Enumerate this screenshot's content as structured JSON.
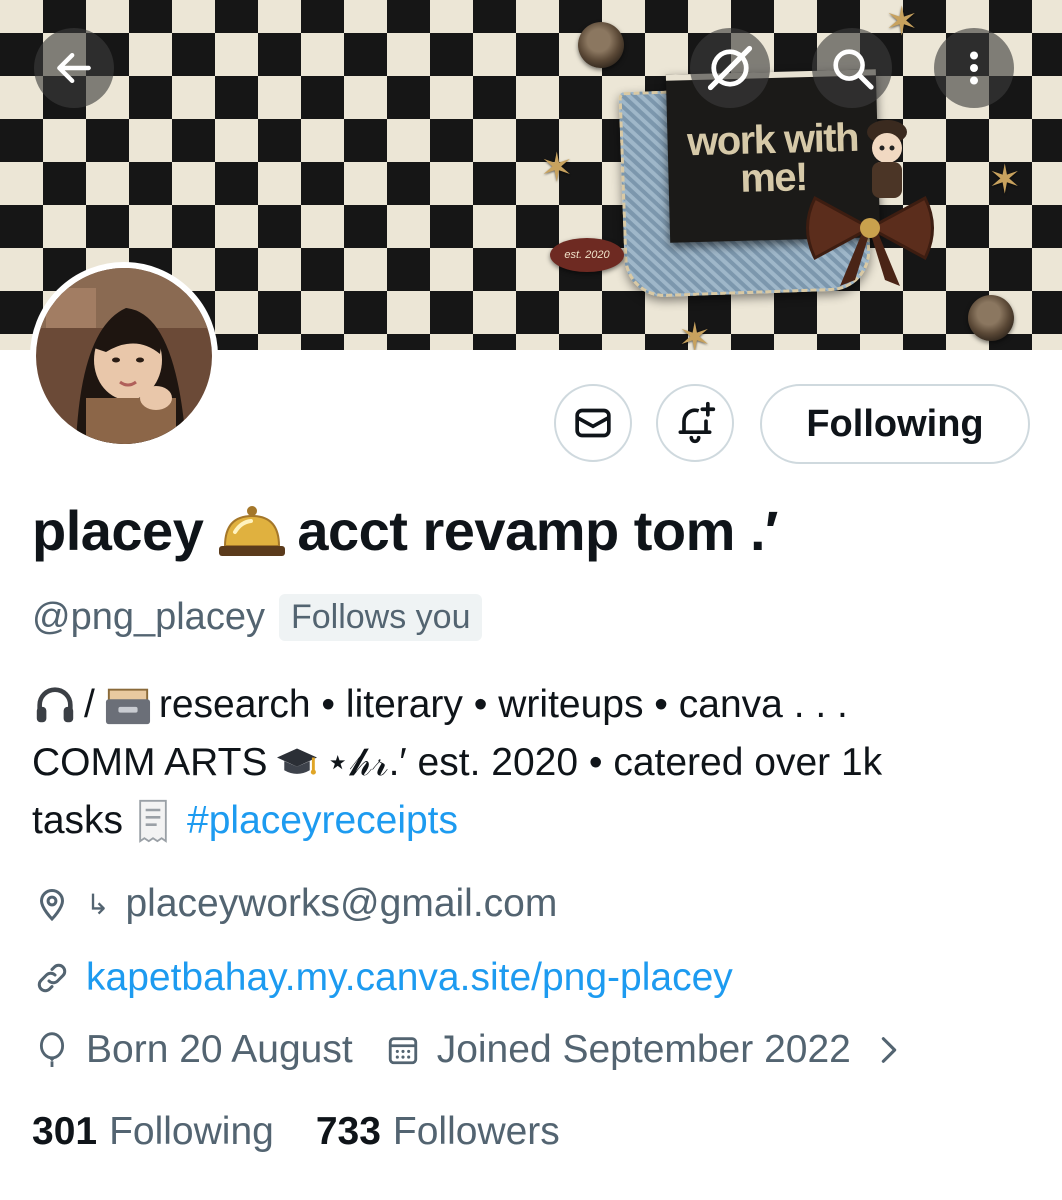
{
  "banner": {
    "card_text": "work with\nme!",
    "badge_text": "est. 2020"
  },
  "profile": {
    "display_name_prefix": "placey",
    "display_name_suffix": "acct revamp tom .′",
    "handle": "@png_placey",
    "follows_you": "Follows you"
  },
  "actions": {
    "following_label": "Following"
  },
  "bio": {
    "line1_sep": "/",
    "line1_text": "research • literary • writeups • canva . . .",
    "line2_a": "COMM ARTS",
    "line2_b": "⋆𝒽𝓇.′ est. 2020 • catered over 1k",
    "line3_a": "tasks",
    "hashtag": "#placeyreceipts"
  },
  "meta": {
    "location_arrow": "↳",
    "location": "placeyworks@gmail.com",
    "website": "kapetbahay.my.canva.site/png-placey",
    "birthday": "Born 20 August",
    "joined": "Joined September 2022"
  },
  "stats": {
    "following_count": "301",
    "following_label": "Following",
    "followers_count": "733",
    "followers_label": "Followers"
  },
  "colors": {
    "accent": "#1d9bf0",
    "secondary_text": "#536471",
    "border": "#cfd9de"
  }
}
